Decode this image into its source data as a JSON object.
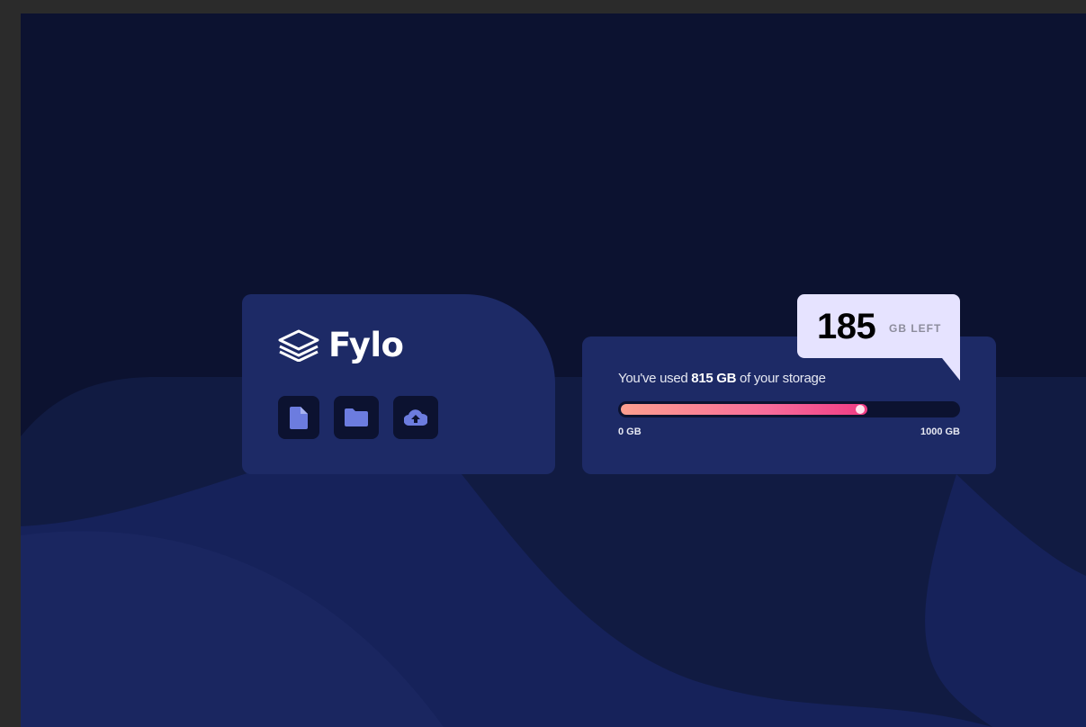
{
  "app": {
    "name": "Fylo"
  },
  "toolbar": {
    "icons": [
      "document-icon",
      "folder-icon",
      "upload-icon"
    ]
  },
  "storage": {
    "used_prefix": "You've used ",
    "used_value": "815 GB",
    "used_suffix": " of your storage",
    "min_label": "0 GB",
    "max_label": "1000 GB",
    "remaining_value": "185",
    "remaining_label": "GB LEFT",
    "usage_fraction": 0.815
  },
  "colors": {
    "background": "#0c1230",
    "card": "#1d2a66",
    "icon_accent": "#6c7cdf",
    "callout": "#e6e3ff",
    "gradient_start": "#fd9f8f",
    "gradient_end": "#ef3b84"
  }
}
